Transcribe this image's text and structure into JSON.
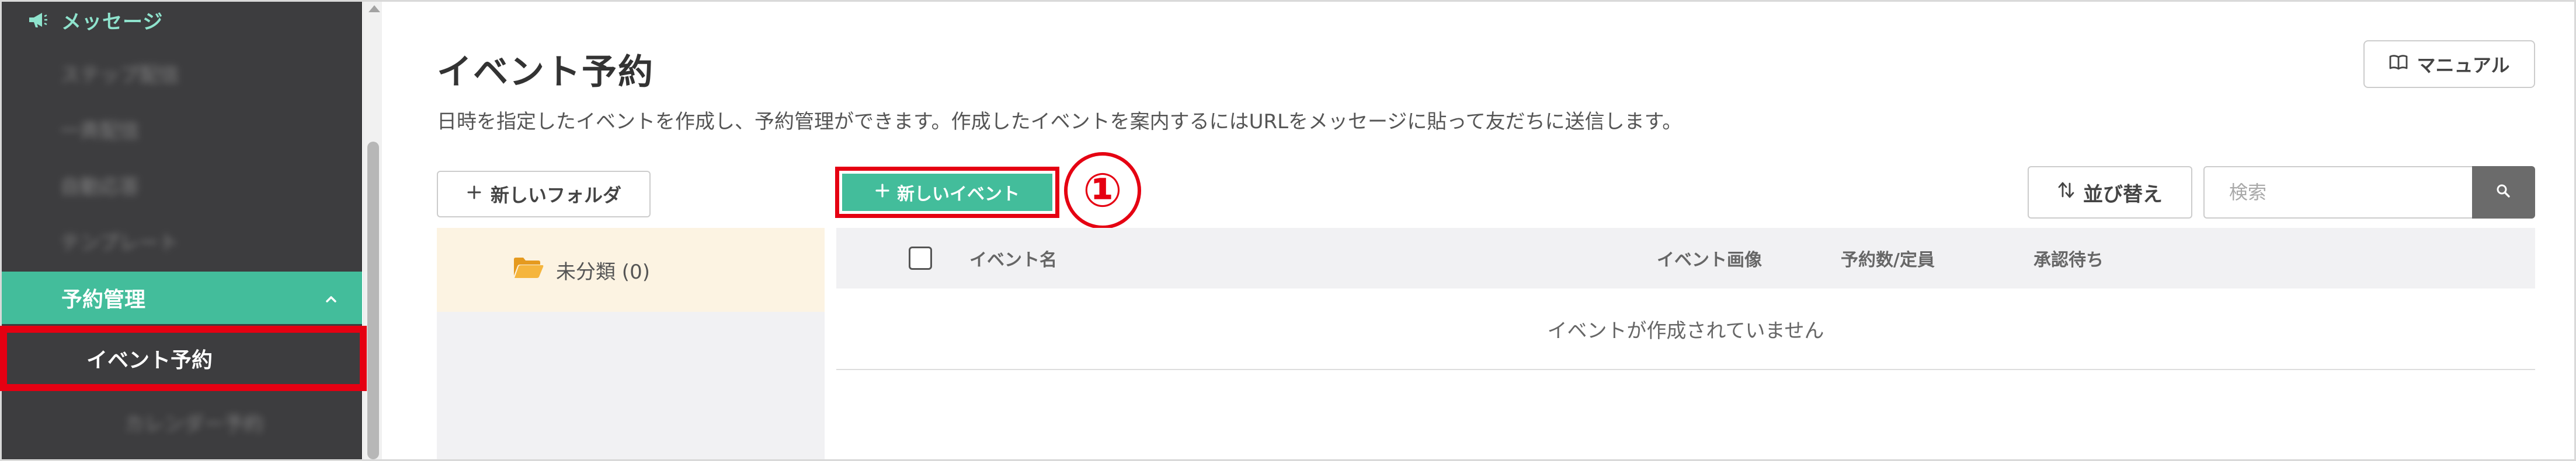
{
  "sidebar": {
    "header_label": "メッセージ",
    "blurred_items": [
      "ステップ配信",
      "一斉配信",
      "自動応答",
      "テンプレート"
    ],
    "section_label": "予約管理",
    "active_item": "イベント予約",
    "bottom_item": "カレンダー予約"
  },
  "page": {
    "title": "イベント予約",
    "description": "日時を指定したイベントを作成し、予約管理ができます。作成したイベントを案内するにはURLをメッセージに貼って友だちに送信します。",
    "manual_label": "マニュアル"
  },
  "toolbar": {
    "new_folder_label": "新しいフォルダ",
    "new_event_label": "新しいイベント",
    "callout_number": "①",
    "sort_label": "並び替え",
    "search_placeholder": "検索"
  },
  "folders": [
    {
      "label": "未分類 (0)"
    }
  ],
  "table": {
    "columns": [
      "イベント名",
      "イベント画像",
      "予約数/定員",
      "承認待ち"
    ],
    "empty_message": "イベントが作成されていません"
  },
  "colors": {
    "accent": "#43bd9b",
    "highlight": "#e50012",
    "sidebar_bg": "#3d3d3f",
    "folder_selected_bg": "#fcf3e2",
    "folder_icon": "#f0a830"
  },
  "icons": {
    "sidebar_header": "megaphone-icon",
    "section_toggle": "chevron-up-icon",
    "manual": "book-icon",
    "add": "plus-icon",
    "sort": "sort-arrows-icon",
    "search": "search-icon",
    "folder": "folder-open-icon"
  }
}
